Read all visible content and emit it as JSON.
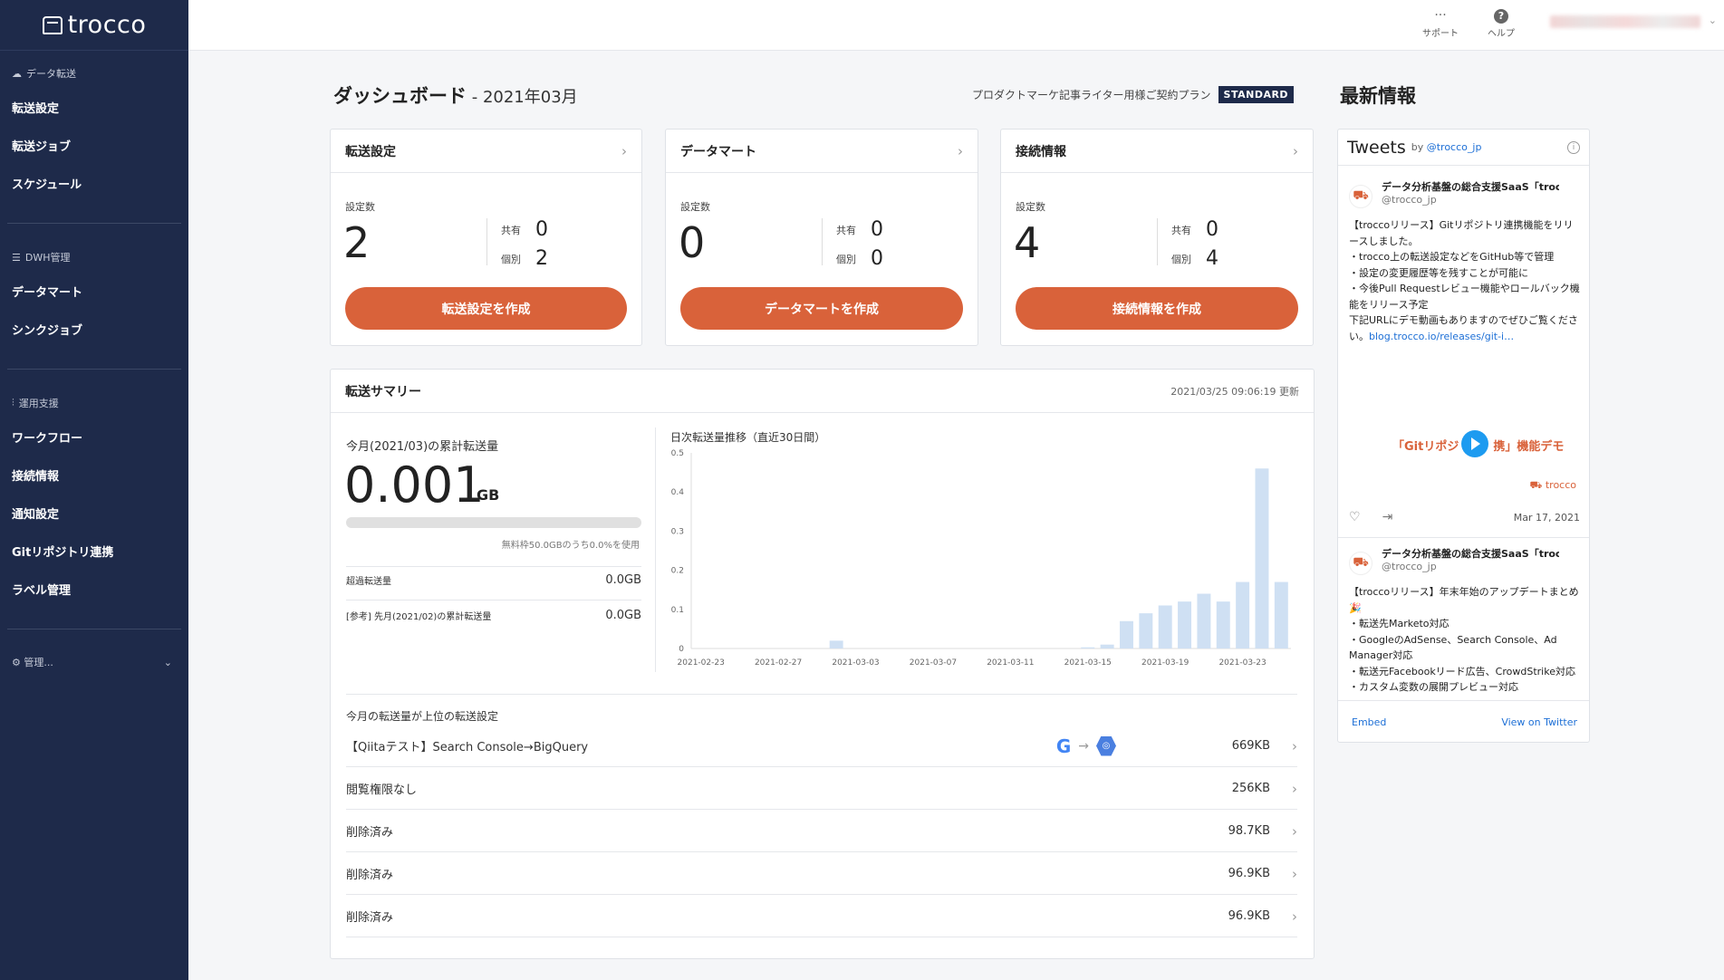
{
  "sidebar": {
    "logo": "trocco",
    "sections": [
      {
        "heading": "データ転送",
        "icon": "cloud-icon",
        "items": [
          "転送設定",
          "転送ジョブ",
          "スケジュール"
        ]
      },
      {
        "heading": "DWH管理",
        "icon": "list-icon",
        "items": [
          "データマート",
          "シンクジョブ"
        ]
      },
      {
        "heading": "運用支援",
        "icon": "sliders-icon",
        "items": [
          "ワークフロー",
          "接続情報",
          "通知設定",
          "Gitリポジトリ連携",
          "ラベル管理"
        ]
      }
    ],
    "admin_label": "管理..."
  },
  "topbar": {
    "support": "サポート",
    "help": "ヘルプ"
  },
  "dashboard": {
    "title": "ダッシュボード",
    "month": " - 2021年03月"
  },
  "plan": {
    "text": "プロダクトマーケ記事ライター用様ご契約プラン",
    "badge": "STANDARD"
  },
  "cards": [
    {
      "title": "転送設定",
      "count_label": "設定数",
      "count": "2",
      "shared_label": "共有",
      "shared": "0",
      "individual_label": "個別",
      "individual": "2",
      "button": "転送設定を作成"
    },
    {
      "title": "データマート",
      "count_label": "設定数",
      "count": "0",
      "shared_label": "共有",
      "shared": "0",
      "individual_label": "個別",
      "individual": "0",
      "button": "データマートを作成"
    },
    {
      "title": "接続情報",
      "count_label": "設定数",
      "count": "4",
      "shared_label": "共有",
      "shared": "0",
      "individual_label": "個別",
      "individual": "4",
      "button": "接続情報を作成"
    }
  ],
  "summary": {
    "title": "転送サマリー",
    "updated": "2021/03/25 09:06:19 更新",
    "month_label": "今月(2021/03)の累計転送量",
    "month_value": "0.001",
    "month_unit": "GB",
    "usage_fraction": 0.0,
    "usage_note": "無料枠50.0GBのうち0.0%を使用",
    "over_label": "超過転送量",
    "over_value": "0.0GB",
    "prev_label": "[参考] 先月(2021/02)の累計転送量",
    "prev_value": "0.0GB",
    "top_heading": "今月の転送量が上位の転送設定",
    "top_rows": [
      {
        "name": "【Qiitaテスト】Search Console→BigQuery",
        "size": "669KB",
        "icons": true
      },
      {
        "name": "閲覧権限なし",
        "size": "256KB",
        "icons": false
      },
      {
        "name": "削除済み",
        "size": "98.7KB",
        "icons": false
      },
      {
        "name": "削除済み",
        "size": "96.9KB",
        "icons": false
      },
      {
        "name": "削除済み",
        "size": "96.9KB",
        "icons": false
      }
    ]
  },
  "chart_data": {
    "type": "bar",
    "title": "日次転送量推移（直近30日間）",
    "x": [
      "2021-02-23",
      "2021-02-24",
      "2021-02-25",
      "2021-02-26",
      "2021-02-27",
      "2021-02-28",
      "2021-03-01",
      "2021-03-02",
      "2021-03-03",
      "2021-03-04",
      "2021-03-05",
      "2021-03-06",
      "2021-03-07",
      "2021-03-08",
      "2021-03-09",
      "2021-03-10",
      "2021-03-11",
      "2021-03-12",
      "2021-03-13",
      "2021-03-14",
      "2021-03-15",
      "2021-03-16",
      "2021-03-17",
      "2021-03-18",
      "2021-03-19",
      "2021-03-20",
      "2021-03-21",
      "2021-03-22",
      "2021-03-23",
      "2021-03-24",
      "2021-03-25"
    ],
    "values": [
      0,
      0,
      0,
      0,
      0,
      0,
      0,
      0.02,
      0,
      0,
      0,
      0,
      0,
      0,
      0,
      0,
      0,
      0,
      0,
      0,
      0.003,
      0.01,
      0.07,
      0.09,
      0.11,
      0.12,
      0.14,
      0.12,
      0.17,
      0.46,
      0.17
    ],
    "x_tick_labels": [
      "2021-02-23",
      "2021-02-27",
      "2021-03-03",
      "2021-03-07",
      "2021-03-11",
      "2021-03-15",
      "2021-03-19",
      "2021-03-23"
    ],
    "y_ticks": [
      "0",
      "0.1",
      "0.2",
      "0.3",
      "0.4",
      "0.5"
    ],
    "ylim": [
      0,
      0.5
    ],
    "color": "#cfe0f3",
    "grid": false
  },
  "news": {
    "title": "最新情報",
    "widget_title": "Tweets",
    "by": "by",
    "handle_link": "@trocco_jp",
    "tweets": [
      {
        "name": "データ分析基盤の総合支援SaaS「trocco」",
        "handle": "@trocco_jp",
        "body_text": "【troccoリリース】Gitリポジトリ連携機能をリリースしました。\n・trocco上の転送設定などをGitHub等で管理\n・設定の変更履歴等を残すことが可能に\n・今後Pull Requestレビュー機能やロールバック機能をリリース予定\n下記URLにデモ動画もありますのでぜひご覧ください。",
        "link": "blog.trocco.io/releases/git-i…"
      },
      {
        "name": "データ分析基盤の総合支援SaaS「trocco」",
        "handle": "@trocco_jp",
        "body_text": "【troccoリリース】年末年始のアップデートまとめ🎉\n・転送先Marketo対応\n・GoogleのAdSense、Search Console、Ad Manager対応\n・転送元Facebookリード広告、CrowdStrike対応\n・カスタム変数の展開プレビュー対応"
      }
    ],
    "media_caption_left": "「Gitリポジ",
    "media_caption_right": "携」機能デモ",
    "media_brand": "trocco",
    "tweet_date": "Mar 17, 2021",
    "embed": "Embed",
    "view_on_twitter": "View on Twitter"
  }
}
